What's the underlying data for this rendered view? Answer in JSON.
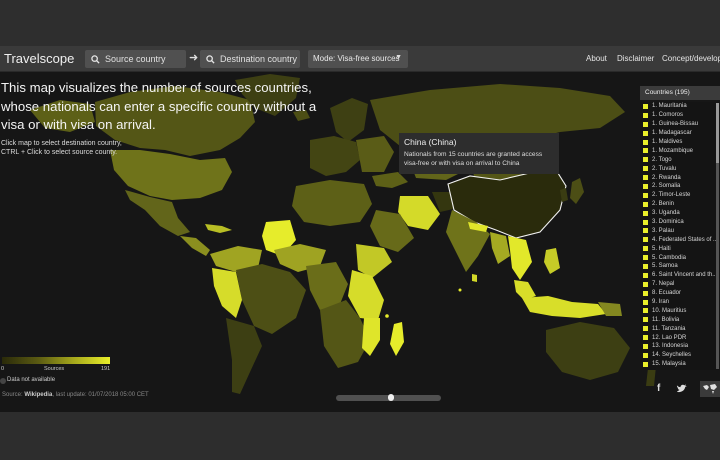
{
  "header": {
    "brand": "Travelscope",
    "source_placeholder": "Source country",
    "destination_placeholder": "Destination country",
    "mode_label": "Mode: Visa-free sources",
    "nav": [
      "About",
      "Disclaimer",
      "Concept/development:"
    ]
  },
  "intro": {
    "text": "This map visualizes the number of sources countries, whose nationals can enter a specific country without a visa or with visa on arrival.",
    "hint_line1": "Click map to select destination country,",
    "hint_line2": "CTRL + Click to select source county."
  },
  "tooltip": {
    "title": "China (China)",
    "body": "Nationals from 15 countries are granted access visa-free or with visa on arrival to China"
  },
  "legend": {
    "min": "0",
    "mid": "Sources",
    "max": "191",
    "not_available": "Data not available"
  },
  "footer": {
    "source_prefix": "Source: ",
    "source_name": "Wikipedia",
    "last_update": ", last update: 01/07/2018 05:00 CET"
  },
  "country_list": {
    "header": "Countries (195)",
    "items": [
      "1. Mauritania",
      "1. Comoros",
      "1. Guinea-Bissau",
      "1. Madagascar",
      "1. Maldives",
      "1. Mozambique",
      "2. Togo",
      "2. Tuvalu",
      "2. Rwanda",
      "2. Somalia",
      "2. Timor-Leste",
      "2. Benin",
      "3. Uganda",
      "3. Dominica",
      "3. Palau",
      "4. Federated States of ...",
      "5. Haiti",
      "5. Cambodia",
      "5. Samoa",
      "6. Saint Vincent and th...",
      "7. Nepal",
      "8. Ecuador",
      "9. Iran",
      "10. Mauritius",
      "11. Bolivia",
      "11. Tanzania",
      "12. Lao PDR",
      "13. Indonesia",
      "14. Seychelles",
      "15. Malaysia"
    ]
  },
  "share": {
    "facebook_glyph": "f",
    "twitter_glyph": "t"
  },
  "colors": {
    "accent": "#e8ee2a",
    "ocean": "#161616",
    "land_low": "#2f300f",
    "land_high": "#e6ec2b"
  }
}
